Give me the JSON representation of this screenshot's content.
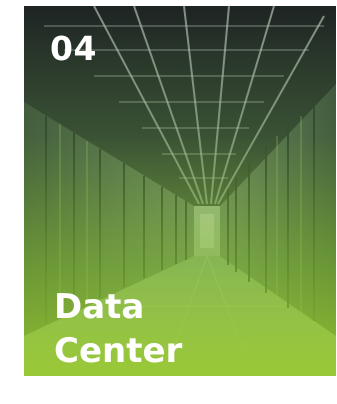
{
  "card": {
    "number": "04",
    "title_line1": "Data",
    "title_line2": "Center",
    "image_subject": "server-aisle-photo",
    "overlay_color": "#96c82d",
    "text_color": "#ffffff"
  }
}
